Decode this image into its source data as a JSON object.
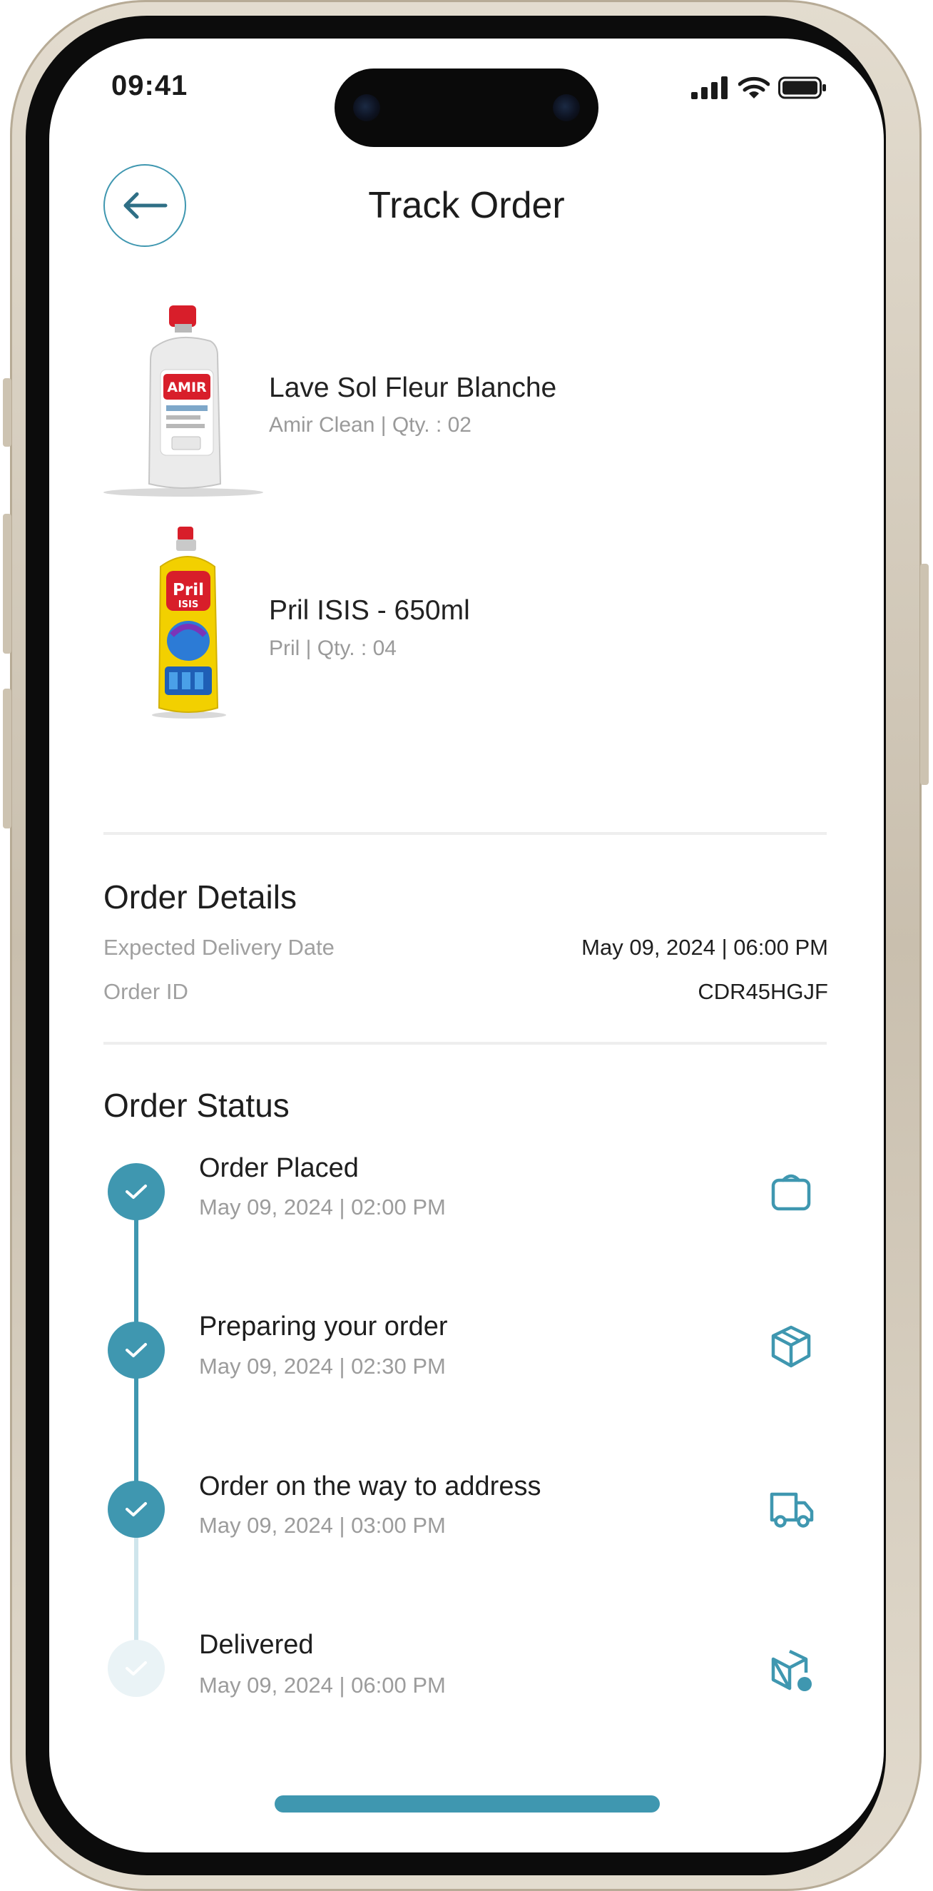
{
  "status_bar": {
    "time": "09:41"
  },
  "header": {
    "title": "Track Order"
  },
  "products": [
    {
      "name": "Lave Sol Fleur Blanche",
      "meta": "Amir Clean | Qty. : 02",
      "brand_text": "AMIR"
    },
    {
      "name": "Pril ISIS - 650ml",
      "meta": "Pril | Qty. : 04",
      "brand_text": "Pril",
      "sub_text": "ISIS"
    }
  ],
  "order_details": {
    "title": "Order Details",
    "rows": [
      {
        "label": "Expected Delivery Date",
        "value": "May 09, 2024 | 06:00 PM"
      },
      {
        "label": "Order ID",
        "value": "CDR45HGJF"
      }
    ]
  },
  "order_status": {
    "title": "Order Status",
    "steps": [
      {
        "title": "Order Placed",
        "time": "May 09, 2024 | 02:00 PM",
        "icon": "shopping-bag-icon",
        "completed": true
      },
      {
        "title": "Preparing your order",
        "time": "May 09, 2024 | 02:30 PM",
        "icon": "package-box-icon",
        "completed": true
      },
      {
        "title": "Order on the way to address",
        "time": "May 09, 2024 | 03:00 PM",
        "icon": "delivery-truck-icon",
        "completed": true
      },
      {
        "title": "Delivered",
        "time": "May 09, 2024 | 06:00 PM",
        "icon": "delivered-box-icon",
        "completed": false
      }
    ]
  },
  "colors": {
    "accent": "#3f97b0",
    "accent_light": "#dcebf0",
    "text": "#1e1e1e",
    "muted": "#9c9c9c"
  }
}
